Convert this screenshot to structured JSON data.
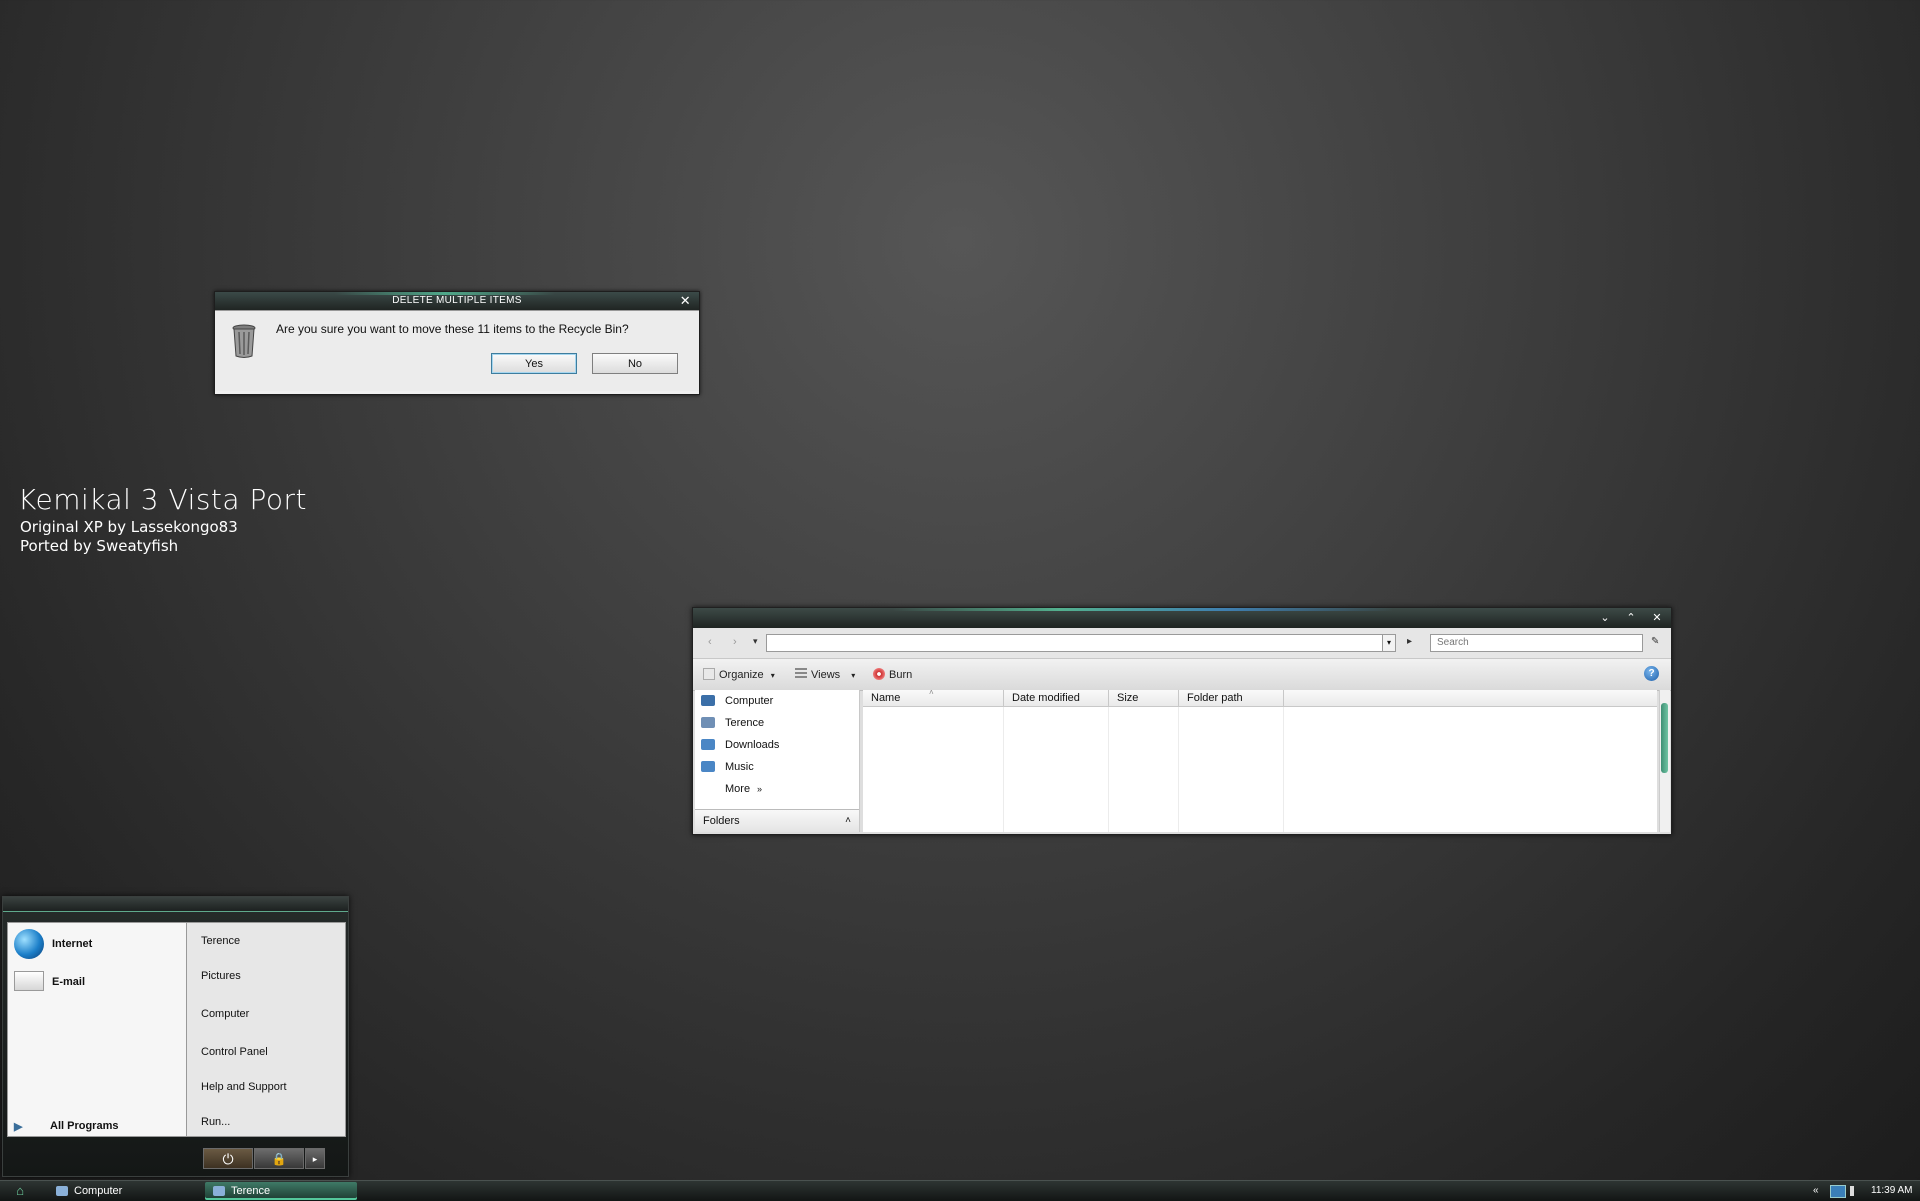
{
  "desktop": {
    "title": "Kemikal 3 Vista Port",
    "line1": "Original XP by Lassekongo83",
    "line2": "Ported by Sweatyfish"
  },
  "dialog": {
    "title": "DELETE MULTIPLE ITEMS",
    "close": "✕",
    "message": "Are you sure you want to move these 11 items to the Recycle Bin?",
    "yes": "Yes",
    "no": "No"
  },
  "explorer": {
    "controls": {
      "minimize": "⌄",
      "maximize": "⌃",
      "close": "✕"
    },
    "nav": {
      "back": "‹",
      "forward": "›",
      "recent": "▾"
    },
    "address": "",
    "address_drop": "▾",
    "go": "▸",
    "search_placeholder": "Search",
    "pin": "✎",
    "commands": {
      "organize": "Organize",
      "views": "Views",
      "burn": "Burn",
      "dropdown": "▾"
    },
    "help": "?",
    "nav_items": [
      {
        "label": "Computer",
        "color": "#3b6fa8"
      },
      {
        "label": "Terence",
        "color": "#6f8fb5"
      },
      {
        "label": "Downloads",
        "color": "#4a86c5"
      },
      {
        "label": "Music",
        "color": "#4a86c5"
      }
    ],
    "more": "More",
    "more_arrows": "»",
    "folders": "Folders",
    "folders_arrow": "˄",
    "columns": [
      "Name",
      "Date modified",
      "Size",
      "Folder path"
    ],
    "sort_indicator": "˄"
  },
  "start_menu": {
    "pinned": [
      {
        "label": "Internet",
        "icon": "globe-icon"
      },
      {
        "label": "E-mail",
        "icon": "mail-icon"
      }
    ],
    "all_programs": "All Programs",
    "all_programs_arrow": "▶",
    "right_items": [
      "Terence",
      "Pictures",
      "Computer",
      "Control Panel",
      "Help and Support",
      "Run..."
    ],
    "power": "⏻",
    "lock": "🔒",
    "more": "▸"
  },
  "taskbar": {
    "start": "⌂",
    "tasks": [
      {
        "label": "Computer",
        "active": false
      },
      {
        "label": "Terence",
        "active": true
      }
    ],
    "tray_arrows": "«",
    "clock": "11:39 AM"
  },
  "colors": {
    "accent": "#54c79b",
    "desktop": "#3e3e3e"
  }
}
